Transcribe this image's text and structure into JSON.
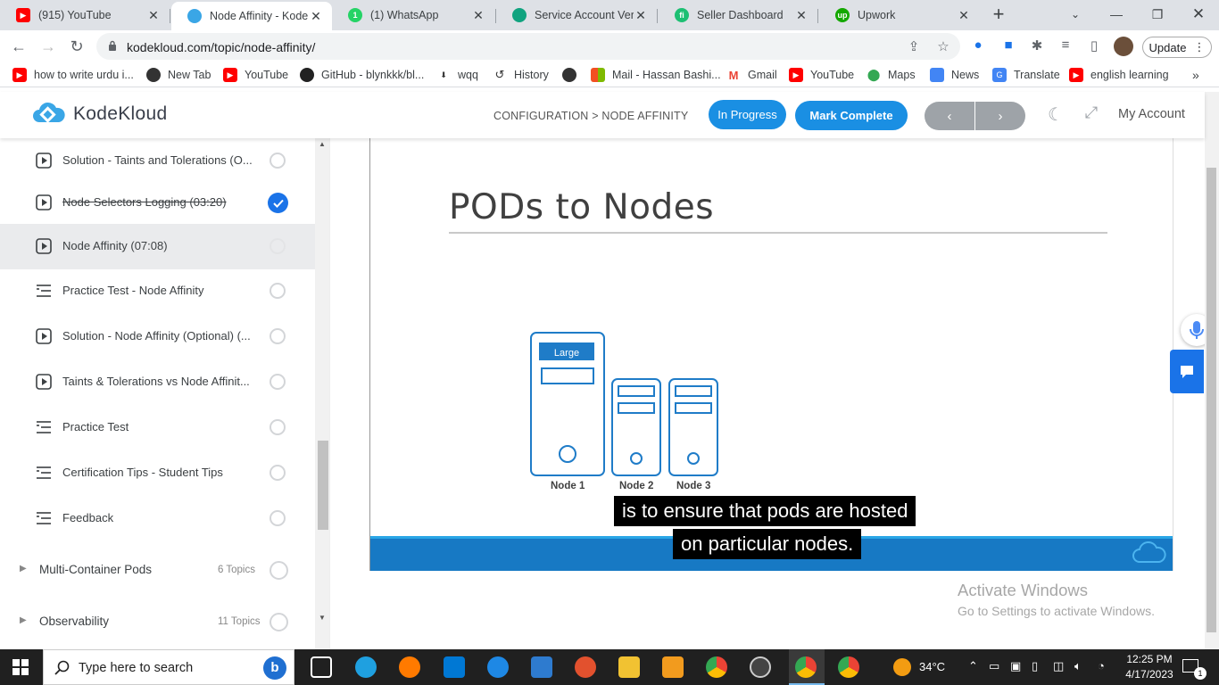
{
  "browser": {
    "tabs": [
      {
        "title": "(915) YouTube",
        "icon": "youtube-icon",
        "color": "#ff0000"
      },
      {
        "title": "Node Affinity - KodeK",
        "icon": "kodekloud-icon",
        "color": "#3aa6e6",
        "active": true
      },
      {
        "title": "(1) WhatsApp",
        "icon": "whatsapp-icon",
        "color": "#25d366"
      },
      {
        "title": "Service Account Versio",
        "icon": "chatgpt-icon",
        "color": "#10a37f"
      },
      {
        "title": "Seller Dashboard",
        "icon": "fiverr-icon",
        "color": "#1dbf73"
      },
      {
        "title": "Upwork",
        "icon": "upwork-icon",
        "color": "#14a800"
      }
    ],
    "url": "kodekloud.com/topic/node-affinity/",
    "update_label": "Update",
    "bookmarks": [
      {
        "label": "how to write urdu i...",
        "icon": "youtube-icon"
      },
      {
        "label": "New Tab",
        "icon": "globe-icon"
      },
      {
        "label": "YouTube",
        "icon": "youtube-icon"
      },
      {
        "label": "GitHub - blynkkk/bl...",
        "icon": "github-icon"
      },
      {
        "label": "wqq",
        "icon": "download-icon"
      },
      {
        "label": "History",
        "icon": "history-icon"
      },
      {
        "label": "",
        "icon": "globe-icon"
      },
      {
        "label": "Mail - Hassan Bashi...",
        "icon": "microsoft-icon"
      },
      {
        "label": "Gmail",
        "icon": "gmail-icon"
      },
      {
        "label": "YouTube",
        "icon": "youtube-icon"
      },
      {
        "label": "Maps",
        "icon": "maps-icon"
      },
      {
        "label": "News",
        "icon": "news-icon"
      },
      {
        "label": "Translate",
        "icon": "translate-icon"
      },
      {
        "label": "english learning",
        "icon": "youtube-icon"
      }
    ]
  },
  "header": {
    "brand": "KodeKloud",
    "breadcrumb": "CONFIGURATION > NODE AFFINITY",
    "progress_label": "In Progress",
    "complete_label": "Mark Complete",
    "prev_label": "‹",
    "next_label": "›",
    "account_label": "My Account",
    "accent_color": "#1a8fe3"
  },
  "sidebar": {
    "lessons": [
      {
        "label": "Solution - Taints and Tolerations (O...",
        "type": "video",
        "done": false,
        "current": false
      },
      {
        "label": "Node Selectors Logging (03:20)",
        "type": "video",
        "done": true,
        "current": false
      },
      {
        "label": "Node Affinity (07:08)",
        "type": "video",
        "done": false,
        "current": true
      },
      {
        "label": "Practice Test - Node Affinity",
        "type": "test",
        "done": false,
        "current": false
      },
      {
        "label": "Solution - Node Affinity (Optional) (...",
        "type": "video",
        "done": false,
        "current": false
      },
      {
        "label": "Taints & Tolerations vs Node Affinit...",
        "type": "video",
        "done": false,
        "current": false
      },
      {
        "label": "Practice Test",
        "type": "test",
        "done": false,
        "current": false
      },
      {
        "label": "Certification Tips - Student Tips",
        "type": "test",
        "done": false,
        "current": false
      },
      {
        "label": "Feedback",
        "type": "test",
        "done": false,
        "current": false
      }
    ],
    "sections": [
      {
        "label": "Multi-Container Pods",
        "count": "6 Topics"
      },
      {
        "label": "Observability",
        "count": "11 Topics"
      }
    ]
  },
  "slide": {
    "title": "PODs to Nodes",
    "large_label": "Large",
    "nodes": [
      "Node 1",
      "Node 2",
      "Node 3"
    ],
    "caption_line1": "is to ensure that pods are hosted",
    "caption_line2": "on particular nodes."
  },
  "watermark": {
    "line1": "Activate Windows",
    "line2": "Go to Settings to activate Windows."
  },
  "taskbar": {
    "search_placeholder": "Type here to search",
    "temperature": "34°C",
    "time": "12:25 PM",
    "date": "4/17/2023",
    "notification_count": "1"
  }
}
